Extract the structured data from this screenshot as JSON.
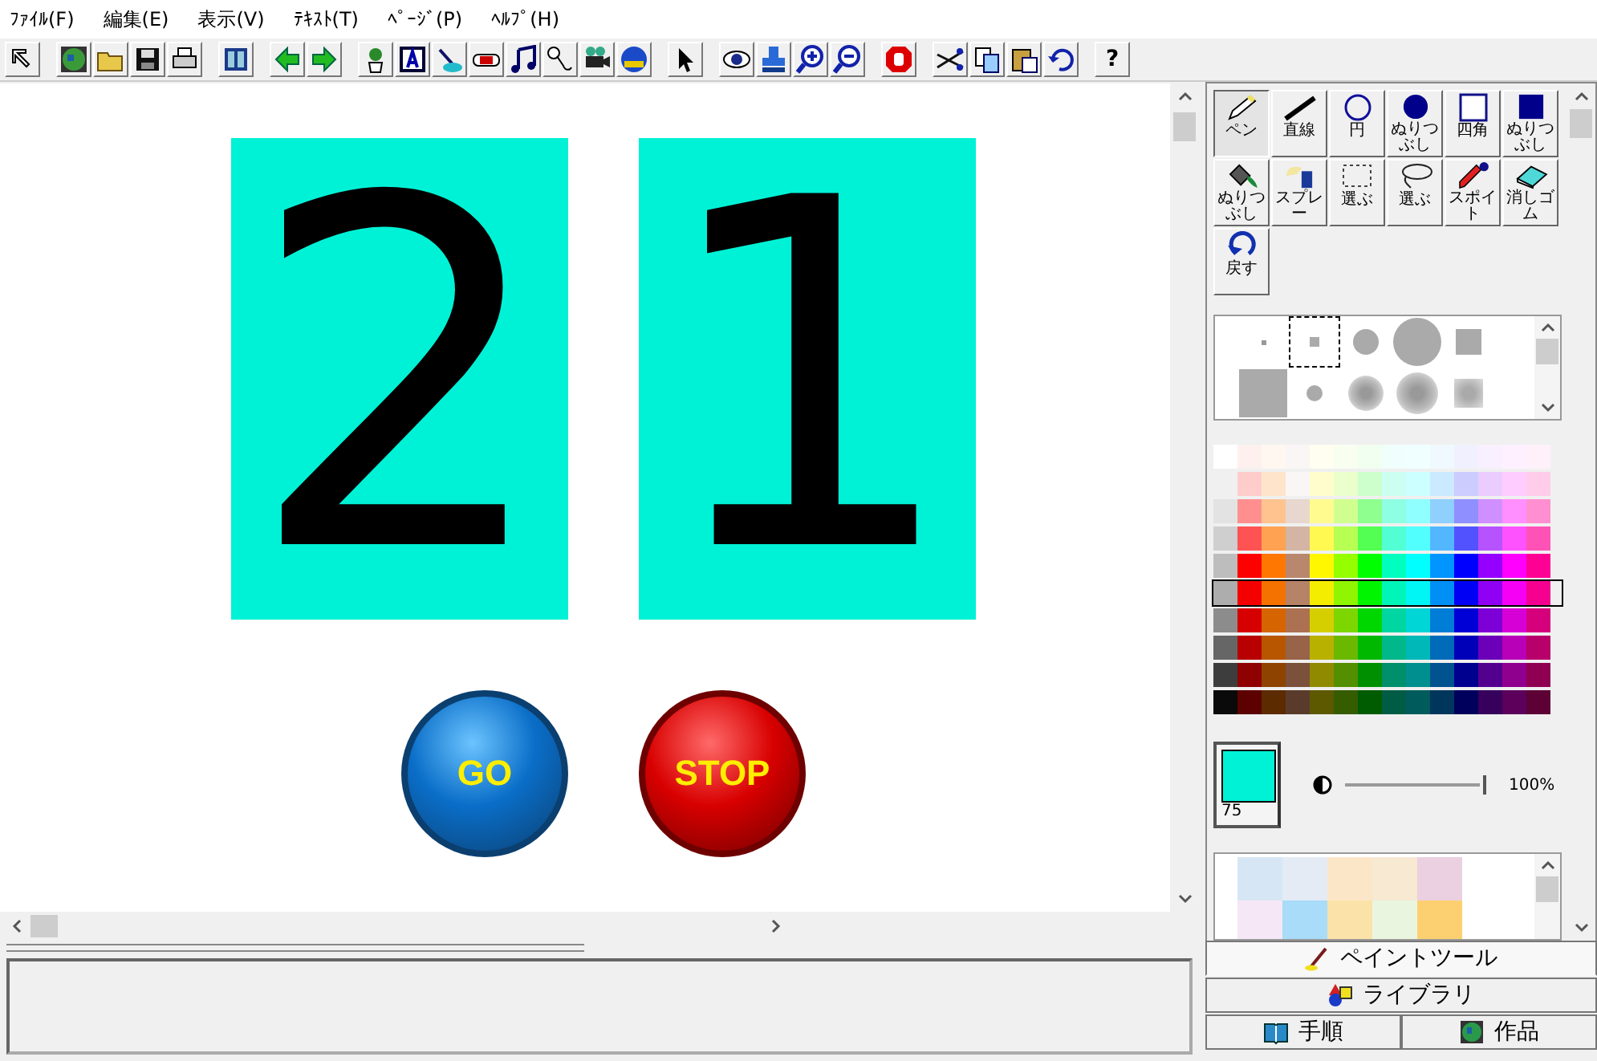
{
  "menu": [
    {
      "label": "ﾌｧｲﾙ(F)"
    },
    {
      "label": "編集(E)"
    },
    {
      "label": "表示(V)"
    },
    {
      "label": "ﾃｷｽﾄ(T)"
    },
    {
      "label": "ﾍﾟｰｼﾞ(P)"
    },
    {
      "label": "ﾍﾙﾌﾟ(H)"
    }
  ],
  "toolbar": {
    "help": "?"
  },
  "canvas": {
    "cards": [
      {
        "text": "2"
      },
      {
        "text": "1"
      }
    ],
    "buttons": [
      {
        "label": "GO",
        "kind": "go"
      },
      {
        "label": "STOP",
        "kind": "stop"
      }
    ]
  },
  "tools": [
    {
      "label": "ペン",
      "selected": true
    },
    {
      "label": "直線",
      "selected": false
    },
    {
      "label": "円",
      "selected": false
    },
    {
      "label": "ぬりつぶし",
      "selected": false
    },
    {
      "label": "四角",
      "selected": false
    },
    {
      "label": "ぬりつぶし",
      "selected": false
    },
    {
      "label": "ぬりつぶし",
      "selected": false
    },
    {
      "label": "スプレー",
      "selected": false
    },
    {
      "label": "選ぶ",
      "selected": false
    },
    {
      "label": "選ぶ",
      "selected": false
    },
    {
      "label": "スポイト",
      "selected": false
    },
    {
      "label": "消しゴム",
      "selected": false
    },
    {
      "label": "戻す",
      "selected": false
    }
  ],
  "brushes": [
    {
      "selected": false
    },
    {
      "selected": true
    },
    {
      "selected": false
    },
    {
      "selected": false
    },
    {
      "selected": false
    },
    {
      "selected": false
    },
    {
      "selected": false
    },
    {
      "selected": false
    },
    {
      "selected": false
    },
    {
      "selected": false
    }
  ],
  "palette_rows": [
    {
      "selected": false
    },
    {
      "selected": false
    },
    {
      "selected": false
    },
    {
      "selected": false
    },
    {
      "selected": false
    },
    {
      "selected": true
    },
    {
      "selected": false
    },
    {
      "selected": false
    },
    {
      "selected": false
    },
    {
      "selected": false
    }
  ],
  "current_color": {
    "color": "#00f2d6",
    "number": "75"
  },
  "opacity": {
    "level": 1,
    "reading": "100%"
  },
  "tabs": [
    {
      "label": "ペイントツール",
      "selected": true
    },
    {
      "label": "ライブラリ",
      "selected": false
    },
    {
      "label": "手順",
      "selected": false
    },
    {
      "label": "作品",
      "selected": false
    }
  ]
}
